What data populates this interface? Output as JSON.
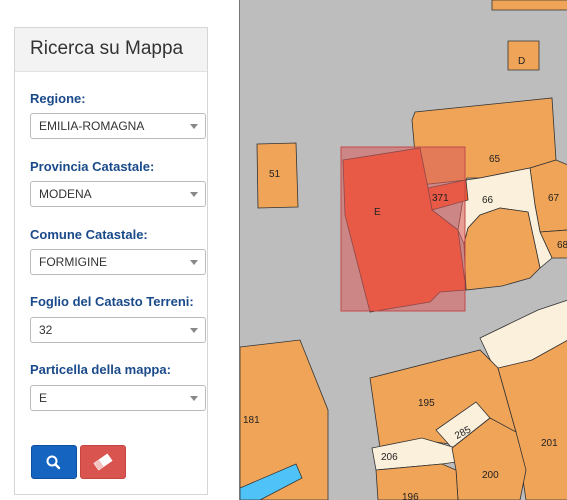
{
  "panel": {
    "title": "Ricerca su Mappa",
    "fields": [
      {
        "label": "Regione:",
        "value": "EMILIA-ROMAGNA"
      },
      {
        "label": "Provincia Catastale:",
        "value": "MODENA"
      },
      {
        "label": "Comune Catastale:",
        "value": "FORMIGINE"
      },
      {
        "label": "Foglio del Catasto Terreni:",
        "value": "32"
      },
      {
        "label": "Particella della mappa:",
        "value": "E"
      }
    ],
    "buttons": {
      "search_icon": "search-icon",
      "clear_icon": "eraser-icon"
    }
  },
  "map": {
    "parcels": [
      "D",
      "51",
      "65",
      "371",
      "E",
      "66",
      "67",
      "68",
      "181",
      "195",
      "285",
      "201",
      "206",
      "200",
      "196"
    ]
  },
  "colors": {
    "map_bg": "#bdbdbd",
    "parcel": "#f0a458",
    "parcel_light": "#fbf0dc",
    "selected": "#fa5a2f",
    "highlight": "#d85a5a",
    "label_blue": "#1a4a8a",
    "search_btn": "#1565c0",
    "clear_btn": "#d9534f"
  }
}
